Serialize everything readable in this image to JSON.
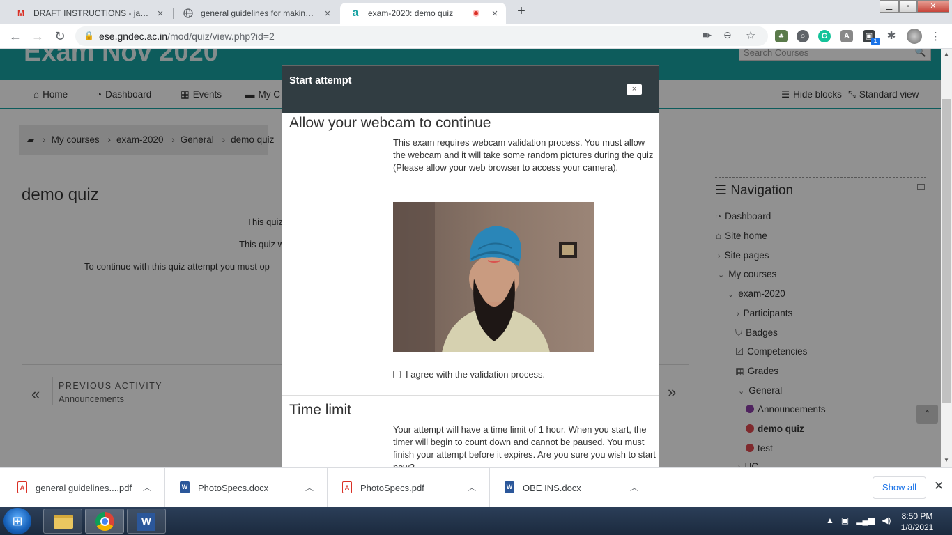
{
  "browser": {
    "tabs": [
      {
        "title": "DRAFT INSTRUCTIONS - jagdeep",
        "icon": "gmail-icon"
      },
      {
        "title": "general guidelines for making qu",
        "icon": "globe-icon"
      },
      {
        "title": "exam-2020: demo quiz",
        "icon": "moodle-icon",
        "active": true
      }
    ],
    "url_host": "ese.gndec.ac.in",
    "url_path": "/mod/quiz/view.php?id=2",
    "extension_badge": "1"
  },
  "site": {
    "title": "Exam Nov 2020",
    "search_placeholder": "Search Courses",
    "nav": [
      "Home",
      "Dashboard",
      "Events",
      "My C"
    ],
    "hide_blocks": "Hide blocks",
    "standard_view": "Standard view",
    "accent_color": "#17a2a2"
  },
  "breadcrumb": [
    "My courses",
    "exam-2020",
    "General",
    "demo quiz"
  ],
  "quiz": {
    "heading": "demo quiz",
    "line1": "This quiz",
    "line2": "This quiz w",
    "line3": "To continue with this quiz attempt you must op"
  },
  "activity_nav": {
    "prev_label": "PREVIOUS ACTIVITY",
    "prev_name": "Announcements"
  },
  "navigation_block": {
    "title": "Navigation",
    "items": [
      {
        "label": "Dashboard"
      },
      {
        "label": "Site home"
      },
      {
        "label": "Site pages"
      },
      {
        "label": "My courses"
      },
      {
        "label": "exam-2020"
      },
      {
        "label": "Participants"
      },
      {
        "label": "Badges"
      },
      {
        "label": "Competencies"
      },
      {
        "label": "Grades"
      },
      {
        "label": "General"
      },
      {
        "label": "Announcements"
      },
      {
        "label": "demo quiz"
      },
      {
        "label": "test"
      },
      {
        "label": "UC"
      }
    ]
  },
  "modal": {
    "title": "Start attempt",
    "close": "×",
    "webcam_heading": "Allow your webcam to continue",
    "webcam_text": "This exam requires webcam validation process. You must allow the webcam and it will take some random pictures during the quiz",
    "webcam_note": "(Please allow your web browser to access your camera).",
    "agree_label": "I agree with the validation process.",
    "time_heading": "Time limit",
    "time_text": "Your attempt will have a time limit of 1 hour. When you start, the timer will begin to count down and cannot be paused. You must finish your attempt before it expires. Are you sure you wish to start now?"
  },
  "downloads": {
    "items": [
      {
        "name": "general guidelines....pdf",
        "type": "pdf"
      },
      {
        "name": "PhotoSpecs.docx",
        "type": "docx"
      },
      {
        "name": "PhotoSpecs.pdf",
        "type": "pdf"
      },
      {
        "name": "OBE INS.docx",
        "type": "docx"
      }
    ],
    "show_all": "Show all"
  },
  "taskbar": {
    "time": "8:50 PM",
    "date": "1/8/2021"
  }
}
